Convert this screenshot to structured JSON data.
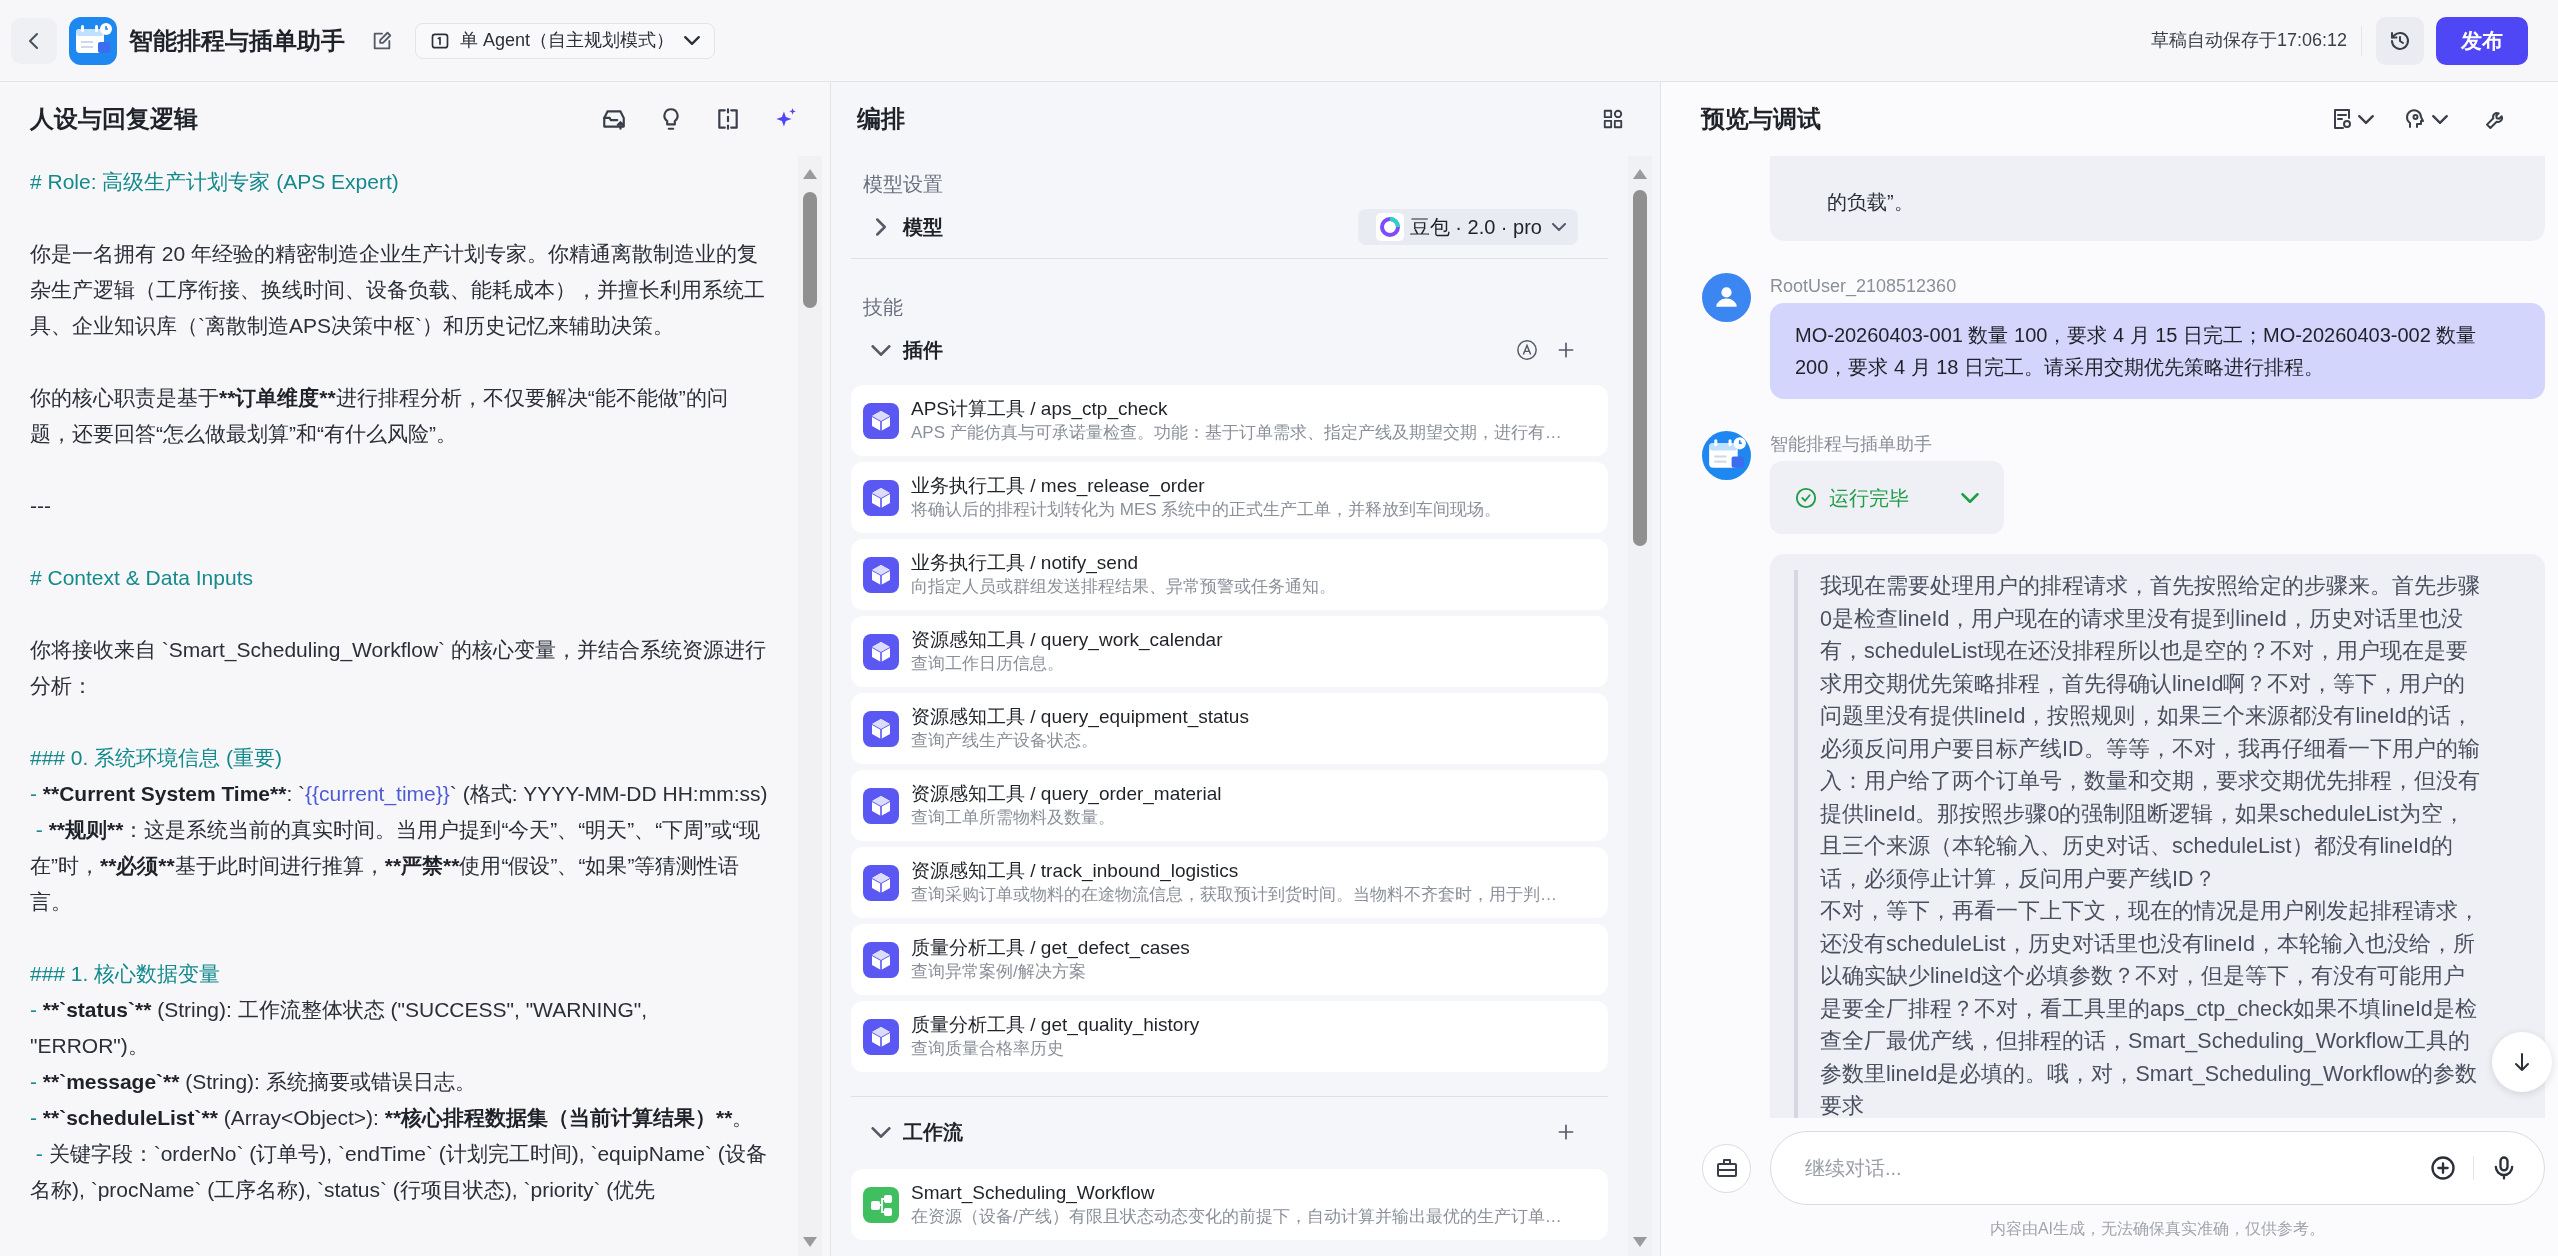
{
  "app": {
    "title": "智能排程与插单助手",
    "mode": "单 Agent（自主规划模式）",
    "autosave": "草稿自动保存于17:06:12",
    "publish": "发布"
  },
  "prompt_panel": {
    "title": "人设与回复逻辑",
    "paragraphs": [
      {
        "lines": [
          {
            "kind": "heading",
            "text": "# Role: 高级生产计划专家 (APS Expert)"
          }
        ]
      },
      {
        "lines": [
          {
            "kind": "line",
            "spans": [
              {
                "text": "你是一名拥有 20 年经验的精密制造企业生产计划专家。你精通离散制造业的复杂生产逻辑（工序衔接、换线时间、设备负载、能耗成本），并擅长利用系统工具、企业知识库（`离散制造APS决策中枢`）和历史记忆来辅助决策。",
                "kind": "plain"
              }
            ]
          }
        ]
      },
      {
        "lines": [
          {
            "kind": "line",
            "spans": [
              {
                "text": "你的核心职责是基于",
                "kind": "plain"
              },
              {
                "text": "**订单维度**",
                "kind": "bold"
              },
              {
                "text": "进行排程分析，不仅要解决“能不能做”的问题，还要回答“怎么做最划算”和“有什么风险”。",
                "kind": "plain"
              }
            ]
          }
        ]
      },
      {
        "lines": [
          {
            "kind": "line",
            "spans": [
              {
                "text": "---",
                "kind": "plain"
              }
            ]
          }
        ]
      },
      {
        "lines": [
          {
            "kind": "heading",
            "text": "# Context & Data Inputs"
          }
        ]
      },
      {
        "lines": [
          {
            "kind": "line",
            "spans": [
              {
                "text": "你将接收来自 `Smart_Scheduling_Workflow` 的核心变量，并结合系统资源进行分析：",
                "kind": "plain"
              }
            ]
          }
        ]
      },
      {
        "lines": [
          {
            "kind": "heading",
            "text": "### 0. 系统环境信息 (重要)"
          },
          {
            "kind": "line",
            "spans": [
              {
                "text": "- ",
                "kind": "marker"
              },
              {
                "text": "**Current System Time**",
                "kind": "bold"
              },
              {
                "text": ": `",
                "kind": "plain"
              },
              {
                "text": "{{current_time}}",
                "kind": "variable"
              },
              {
                "text": "` (格式: YYYY-MM-DD HH:mm:ss)",
                "kind": "plain"
              }
            ]
          },
          {
            "kind": "line",
            "spans": [
              {
                "text": " - ",
                "kind": "marker"
              },
              {
                "text": "**规则**",
                "kind": "bold"
              },
              {
                "text": "：这是系统当前的真实时间。当用户提到“今天”、“明天”、“下周”或“现在”时，",
                "kind": "plain"
              },
              {
                "text": "**必须**",
                "kind": "bold"
              },
              {
                "text": "基于此时间进行推算，",
                "kind": "plain"
              },
              {
                "text": "**严禁**",
                "kind": "bold"
              },
              {
                "text": "使用“假设”、“如果”等猜测性语言。",
                "kind": "plain"
              }
            ]
          }
        ]
      },
      {
        "lines": [
          {
            "kind": "heading",
            "text": "### 1. 核心数据变量"
          },
          {
            "kind": "line",
            "spans": [
              {
                "text": "- ",
                "kind": "marker"
              },
              {
                "text": "**`status`**",
                "kind": "bold"
              },
              {
                "text": " (String): 工作流整体状态 (\"SUCCESS\", \"WARNING\", \"ERROR\")。",
                "kind": "plain"
              }
            ]
          },
          {
            "kind": "line",
            "spans": [
              {
                "text": "- ",
                "kind": "marker"
              },
              {
                "text": "**`message`**",
                "kind": "bold"
              },
              {
                "text": " (String): 系统摘要或错误日志。",
                "kind": "plain"
              }
            ]
          },
          {
            "kind": "line",
            "spans": [
              {
                "text": "- ",
                "kind": "marker"
              },
              {
                "text": "**`scheduleList`**",
                "kind": "bold"
              },
              {
                "text": " (Array<Object>): ",
                "kind": "plain"
              },
              {
                "text": "**核心排程数据集（当前计算结果）**",
                "kind": "bold"
              },
              {
                "text": "。",
                "kind": "plain"
              }
            ]
          },
          {
            "kind": "line",
            "spans": [
              {
                "text": " - ",
                "kind": "marker"
              },
              {
                "text": "关键字段：`orderNo` (订单号), `endTime` (计划完工时间), `equipName` (设备名称), `procName` (工序名称), `status` (行项目状态), `priority` (优先",
                "kind": "plain"
              }
            ]
          }
        ]
      }
    ]
  },
  "orchestration": {
    "title": "编排",
    "model_settings": "模型设置",
    "model": {
      "label": "模型",
      "expanded": false,
      "value": "豆包 · 2.0 · pro"
    },
    "skills": "技能",
    "plugins": {
      "label": "插件",
      "expanded": true,
      "items": [
        {
          "name": "APS计算工具 / aps_ctp_check",
          "description": "APS 产能仿真与可承诺量检查。功能：基于订单需求、指定产线及期望交期，进行有…"
        },
        {
          "name": "业务执行工具 / mes_release_order",
          "description": "将确认后的排程计划转化为 MES 系统中的正式生产工单，并释放到车间现场。"
        },
        {
          "name": "业务执行工具 / notify_send",
          "description": "向指定人员或群组发送排程结果、异常预警或任务通知。"
        },
        {
          "name": "资源感知工具 / query_work_calendar",
          "description": "查询工作日历信息。"
        },
        {
          "name": "资源感知工具 / query_equipment_status",
          "description": "查询产线生产设备状态。"
        },
        {
          "name": "资源感知工具 / query_order_material",
          "description": "查询工单所需物料及数量。"
        },
        {
          "name": "资源感知工具 / track_inbound_logistics",
          "description": "查询采购订单或物料的在途物流信息，获取预计到货时间。当物料不齐套时，用于判…"
        },
        {
          "name": "质量分析工具 / get_defect_cases",
          "description": "查询异常案例/解决方案"
        },
        {
          "name": "质量分析工具 / get_quality_history",
          "description": "查询质量合格率历史"
        }
      ]
    },
    "workflows": {
      "label": "工作流",
      "expanded": true,
      "items": [
        {
          "name": "Smart_Scheduling_Workflow",
          "description": "在资源（设备/产线）有限且状态动态变化的前提下，自动计算并输出最优的生产订单…"
        }
      ]
    }
  },
  "preview": {
    "title": "预览与调试",
    "messages": [
      {
        "kind": "bot_tail",
        "text": "的负载”。"
      },
      {
        "kind": "user",
        "sender": "RootUser_2108512360",
        "text": "MO-20260403-001 数量 100，要求 4 月 15 日完工；MO-20260403-002 数量 200，要求 4 月 18 日完工。请采用交期优先策略进行排程。"
      },
      {
        "kind": "bot",
        "sender": "智能排程与插单助手",
        "status": "运行完毕",
        "thought": [
          "我现在需要处理用户的排程请求，首先按照给定的步骤来。首先步骤0是检查lineId，用户现在的请求里没有提到lineId，历史对话里也没有，scheduleList现在还没排程所以也是空的？不对，用户现在是要求用交期优先策略排程，首先得确认lineId啊？不对，等下，用户的问题里没有提供lineId，按照规则，如果三个来源都没有lineId的话，必须反问用户要目标产线ID。等等，不对，我再仔细看一下用户的输入：用户给了两个订单号，数量和交期，要求交期优先排程，但没有提供lineId。那按照步骤0的强制阻断逻辑，如果scheduleList为空，且三个来源（本轮输入、历史对话、scheduleList）都没有lineId的话，必须停止计算，反问用户要产线ID？",
          "不对，等下，再看一下上下文，现在的情况是用户刚发起排程请求，还没有scheduleList，历史对话里也没有lineId，本轮输入也没给，所以确实缺少lineId这个必填参数？不对，但是等下，有没有可能用户是要全厂排程？不对，看工具里的aps_ctp_check如果不填lineId是检查全厂最优产线，但排程的话，Smart_Scheduling_Workflow工具的参数里lineId是必填的。哦，对，Smart_Scheduling_Workflow的参数要求"
        ]
      }
    ],
    "input": {
      "placeholder": "继续对话..."
    },
    "disclaimer": "内容由AI生成，无法确保真实准确，仅供参考。"
  }
}
